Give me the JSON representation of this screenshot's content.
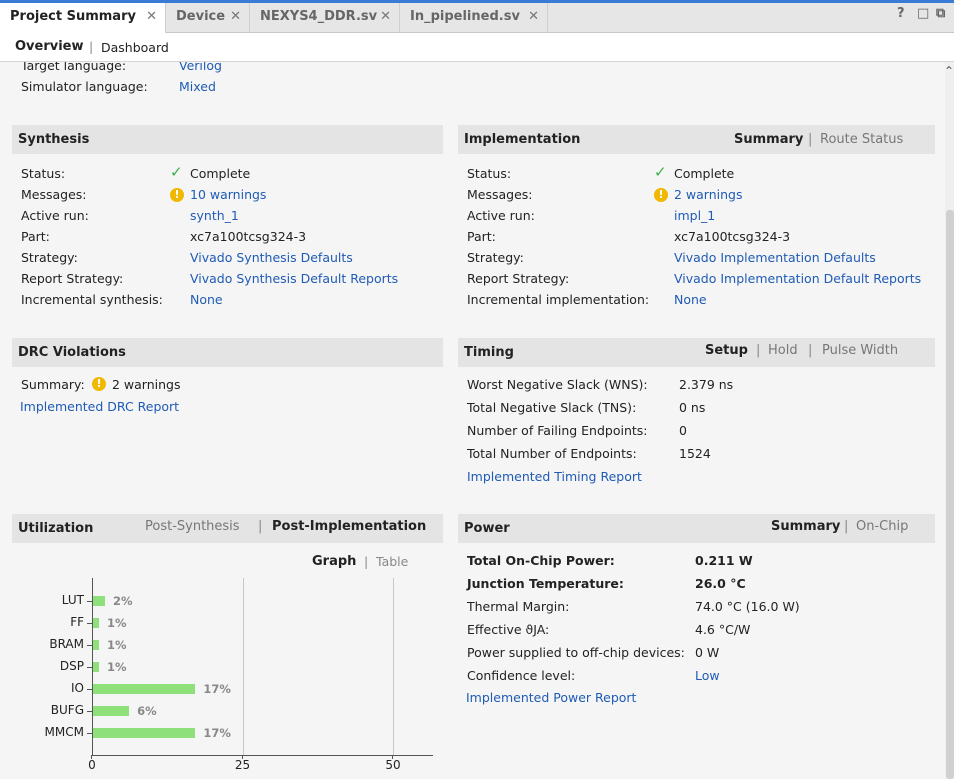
{
  "tabs": [
    {
      "label": "Project Summary"
    },
    {
      "label": "Device"
    },
    {
      "label": "NEXYS4_DDR.sv"
    },
    {
      "label": "In_pipelined.sv"
    }
  ],
  "window_controls": {
    "help": "?",
    "restore": "□",
    "float": "⧉"
  },
  "subtabs": {
    "overview": "Overview",
    "dashboard": "Dashboard"
  },
  "settings": {
    "target_language_label": "Target language:",
    "target_language_value": "Verilog",
    "simulator_language_label": "Simulator language:",
    "simulator_language_value": "Mixed"
  },
  "synthesis": {
    "title": "Synthesis",
    "rows": [
      {
        "label": "Status:",
        "value": "Complete"
      },
      {
        "label": "Messages:",
        "value": "10 warnings"
      },
      {
        "label": "Active run:",
        "value": "synth_1"
      },
      {
        "label": "Part:",
        "value": "xc7a100tcsg324-3"
      },
      {
        "label": "Strategy:",
        "value": "Vivado Synthesis Defaults"
      },
      {
        "label": "Report Strategy:",
        "value": "Vivado Synthesis Default Reports"
      },
      {
        "label": "Incremental synthesis:",
        "value": "None"
      }
    ]
  },
  "implementation": {
    "title": "Implementation",
    "tab_summary": "Summary",
    "tab_route": "Route Status",
    "rows": [
      {
        "label": "Status:",
        "value": "Complete"
      },
      {
        "label": "Messages:",
        "value": "2 warnings"
      },
      {
        "label": "Active run:",
        "value": "impl_1"
      },
      {
        "label": "Part:",
        "value": "xc7a100tcsg324-3"
      },
      {
        "label": "Strategy:",
        "value": "Vivado Implementation Defaults"
      },
      {
        "label": "Report Strategy:",
        "value": "Vivado Implementation Default Reports"
      },
      {
        "label": "Incremental implementation:",
        "value": "None"
      }
    ]
  },
  "drc": {
    "title": "DRC Violations",
    "summary_label": "Summary:",
    "summary_value": "2 warnings",
    "report_link": "Implemented DRC Report"
  },
  "timing": {
    "title": "Timing",
    "tab_setup": "Setup",
    "tab_hold": "Hold",
    "tab_pulse": "Pulse Width",
    "rows": [
      {
        "label": "Worst Negative Slack (WNS):",
        "value": "2.379 ns"
      },
      {
        "label": "Total Negative Slack (TNS):",
        "value": "0 ns"
      },
      {
        "label": "Number of Failing Endpoints:",
        "value": "0"
      },
      {
        "label": "Total Number of Endpoints:",
        "value": "1524"
      }
    ],
    "report_link": "Implemented Timing Report"
  },
  "utilization": {
    "title": "Utilization",
    "tab_post_synth": "Post-Synthesis",
    "tab_post_impl": "Post-Implementation",
    "view_graph": "Graph",
    "view_table": "Table"
  },
  "chart_data": {
    "type": "bar",
    "orientation": "horizontal",
    "categories": [
      "LUT",
      "FF",
      "BRAM",
      "DSP",
      "IO",
      "BUFG",
      "MMCM"
    ],
    "values": [
      2,
      1,
      1,
      1,
      17,
      6,
      17
    ],
    "value_labels": [
      "2%",
      "1%",
      "1%",
      "1%",
      "17%",
      "6%",
      "17%"
    ],
    "xticks": [
      "0",
      "25",
      "50"
    ],
    "xlim": [
      0,
      57
    ],
    "grid": true,
    "bar_color": "#8ee07a"
  },
  "power": {
    "title": "Power",
    "tab_summary": "Summary",
    "tab_onchip": "On-Chip",
    "rows": [
      {
        "label": "Total On-Chip Power:",
        "value": "0.211 W"
      },
      {
        "label": "Junction Temperature:",
        "value": "26.0 °C"
      },
      {
        "label": "Thermal Margin:",
        "value": "74.0 °C (16.0 W)"
      },
      {
        "label": "Effective ϑJA:",
        "value": "4.6 °C/W"
      },
      {
        "label": "Power supplied to off-chip devices:",
        "value": "0 W"
      },
      {
        "label": "Confidence level:",
        "value": "Low"
      }
    ],
    "report_link": "Implemented Power Report"
  },
  "colors": {
    "link": "#1f5bb5",
    "accent": "#3a7bd5",
    "ok": "#3fae49",
    "warning": "#f0b800",
    "bar": "#8ee07a"
  }
}
